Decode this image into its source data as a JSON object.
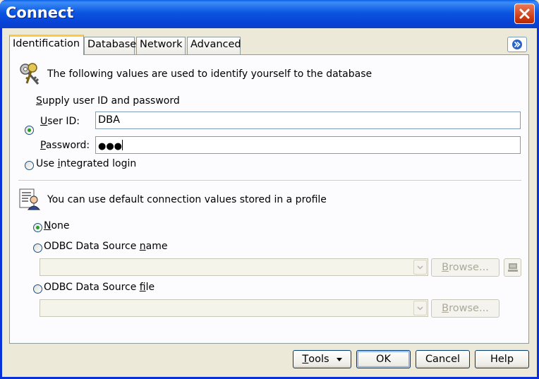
{
  "window": {
    "title": "Connect"
  },
  "tabs": [
    {
      "label": "Identification",
      "active": true
    },
    {
      "label": "Database",
      "active": false
    },
    {
      "label": "Network",
      "active": false
    },
    {
      "label": "Advanced",
      "active": false
    }
  ],
  "identification": {
    "description": "The following values are used to identify yourself to the database",
    "supply_option": {
      "pre": "",
      "accel": "S",
      "post": "upply user ID and password",
      "checked": true
    },
    "user_id": {
      "label_accel": "U",
      "label_post": "ser ID:",
      "value": "DBA"
    },
    "password": {
      "label_accel": "P",
      "label_post": "assword:",
      "masked_value": "●●●"
    },
    "integrated_option": {
      "pre": "Use ",
      "accel": "i",
      "post": "ntegrated login",
      "checked": false
    }
  },
  "profile": {
    "description": "You can use default connection values stored in a profile",
    "none_option": {
      "pre": "",
      "accel": "N",
      "post": "one",
      "checked": true
    },
    "dsn_name_option": {
      "pre": "ODBC Data Source ",
      "accel": "n",
      "post": "ame",
      "checked": false
    },
    "dsn_name_value": "",
    "dsn_file_option": {
      "pre": "ODBC Data Source ",
      "accel": "f",
      "post": "ile",
      "checked": false
    },
    "dsn_file_value": "",
    "browse_label": {
      "accel": "B",
      "post": "rowse..."
    }
  },
  "footer": {
    "tools": {
      "accel": "T",
      "post": "ools"
    },
    "ok": "OK",
    "cancel": "Cancel",
    "help": "Help"
  },
  "icons": {
    "keys": "keys-icon",
    "profile": "profile-card-icon",
    "odbc_admin": "odbc-admin-icon",
    "close": "close-icon",
    "expand": "double-chevron-right-icon"
  },
  "colors": {
    "titlebar": "#0a55e0",
    "close": "#cc3a12",
    "active_tab_accent": "#ffc83c",
    "radio_dot": "#21a121"
  }
}
